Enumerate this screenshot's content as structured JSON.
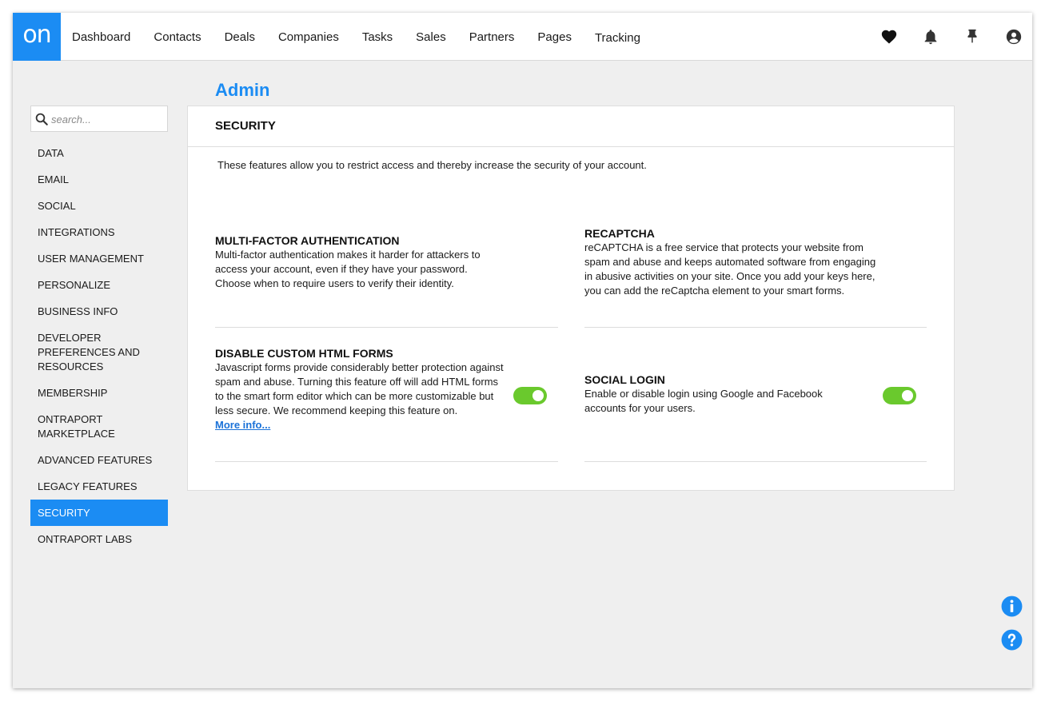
{
  "app": {
    "logo_text": "on",
    "brand_color": "#1b8cf3",
    "toggle_on_color": "#6ac92d"
  },
  "nav": {
    "items": [
      "Dashboard",
      "Contacts",
      "Deals",
      "Companies",
      "Tasks",
      "Sales",
      "Partners",
      "Pages",
      "Tracking"
    ],
    "icons": [
      "heart-icon",
      "bell-icon",
      "pin-icon",
      "account-icon"
    ]
  },
  "sidebar": {
    "search_placeholder": "search...",
    "items": [
      "DATA",
      "EMAIL",
      "SOCIAL",
      "INTEGRATIONS",
      "USER MANAGEMENT",
      "PERSONALIZE",
      "BUSINESS INFO",
      "DEVELOPER PREFERENCES AND RESOURCES",
      "MEMBERSHIP",
      "ONTRAPORT MARKETPLACE",
      "ADVANCED FEATURES",
      "LEGACY FEATURES",
      "SECURITY",
      "ONTRAPORT LABS"
    ],
    "active": "SECURITY"
  },
  "page": {
    "title": "Admin",
    "section_title": "SECURITY",
    "intro": "These features allow you to restrict access and thereby increase the security of your account."
  },
  "features": {
    "mfa": {
      "title": "MULTI-FACTOR AUTHENTICATION",
      "description": "Multi-factor authentication makes it harder for attackers to access your account, even if they have your password. Choose when to require users to verify their identity."
    },
    "recaptcha": {
      "title": "RECAPTCHA",
      "description": "reCAPTCHA is a free service that protects your website from spam and abuse and keeps automated software from engaging in abusive activities on your site. Once you add your keys here, you can add the reCaptcha element to your smart forms."
    },
    "custom_html": {
      "title": "DISABLE CUSTOM HTML FORMS",
      "description": "Javascript forms provide considerably better protection against spam and abuse. Turning this feature off will add HTML forms to the smart form editor which can be more customizable but less secure. We recommend keeping this feature on.",
      "link": "More info...",
      "enabled": true
    },
    "social_login": {
      "title": "SOCIAL LOGIN",
      "description": "Enable or disable login using Google and Facebook accounts for your users.",
      "enabled": true
    }
  },
  "help": {
    "icons": [
      "info-icon",
      "question-icon"
    ]
  }
}
